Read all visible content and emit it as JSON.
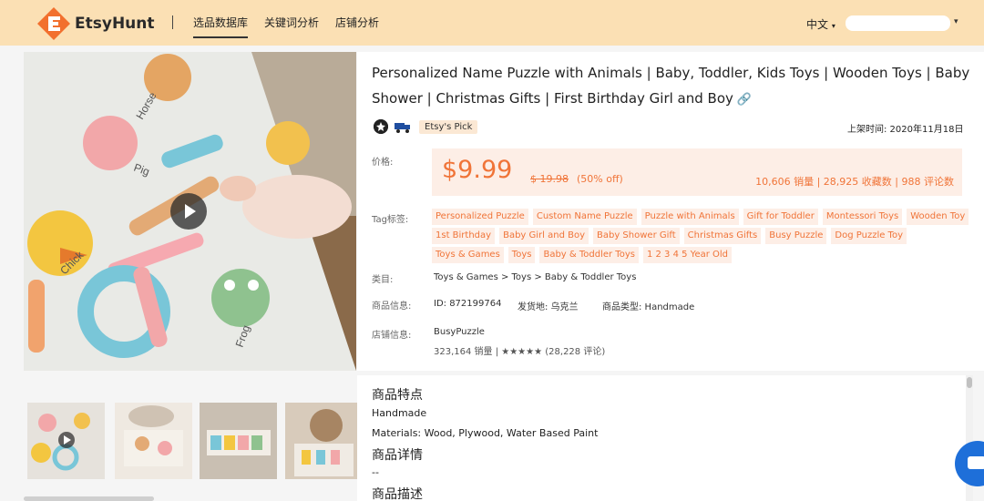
{
  "header": {
    "logo_text": "EtsyHunt",
    "nav": [
      "选品数据库",
      "关键词分析",
      "店铺分析"
    ],
    "lang": "中文"
  },
  "product": {
    "title": "Personalized Name Puzzle with Animals | Baby, Toddler, Kids Toys | Wooden Toys | Baby Shower | Christmas Gifts | First Birthday Girl and Boy",
    "badge": "Etsy's Pick",
    "listed_date": "上架时间: 2020年11月18日",
    "price_label": "价格:",
    "price": "$9.99",
    "old_price": "$ 19.98",
    "discount": "(50% off)",
    "stats": "10,606 销量 | 28,925 收藏数 | 988 评论数",
    "tag_label": "Tag标签:",
    "tags": [
      "Personalized Puzzle",
      "Custom Name Puzzle",
      "Puzzle with Animals",
      "Gift for Toddler",
      "Montessori Toys",
      "Wooden Toy",
      "1st Birthday",
      "Baby Girl and Boy",
      "Baby Shower Gift",
      "Christmas Gifts",
      "Busy Puzzle",
      "Dog Puzzle Toy",
      "Toys & Games",
      "Toys",
      "Baby & Toddler Toys",
      "1 2 3 4 5 Year Old"
    ],
    "category_label": "类目:",
    "category": "Toys & Games   > Toys > Baby & Toddler Toys",
    "info_label": "商品信息:",
    "id": "ID: 872199764",
    "ship_from": "发货地: 乌克兰",
    "type": "商品类型: Handmade",
    "shop_label": "店铺信息:",
    "shop_name": "BusyPuzzle",
    "shop_stats": "323,164 销量 | ★★★★★ (28,228 评论)"
  },
  "details": {
    "features_title": "商品特点",
    "feature_1": "Handmade",
    "feature_2": "Materials: Wood, Plywood, Water Based Paint",
    "detail_title": "商品详情",
    "detail_text": "--",
    "desc_title": "商品描述"
  },
  "colors": {
    "header_bg": "#fbe0b4",
    "accent": "#f07438",
    "tag_bg": "#fdeee6"
  }
}
